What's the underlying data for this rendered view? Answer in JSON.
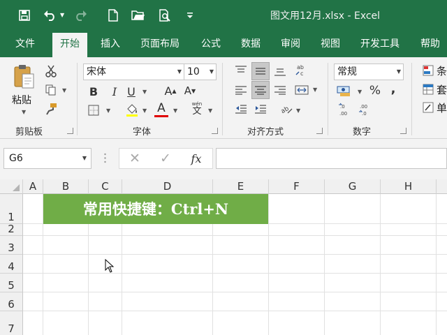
{
  "window": {
    "title": "图文用12月.xlsx  -  Excel"
  },
  "ribbon_tabs": [
    "文件",
    "开始",
    "插入",
    "页面布局",
    "公式",
    "数据",
    "审阅",
    "视图",
    "开发工具",
    "帮助"
  ],
  "clipboard": {
    "paste_label": "粘贴",
    "group_label": "剪贴板"
  },
  "font": {
    "name": "宋体",
    "size": "10",
    "group_label": "字体",
    "wen_ruby": "wén",
    "wen_char": "文"
  },
  "alignment": {
    "group_label": "对齐方式"
  },
  "number": {
    "format": "常规",
    "group_label": "数字",
    "percent": "%",
    "comma": ","
  },
  "styles": {
    "items": [
      "条",
      "套",
      "单"
    ]
  },
  "formula_bar": {
    "cell_ref": "G6",
    "fx": "fx",
    "value": ""
  },
  "grid": {
    "columns": [
      "A",
      "B",
      "C",
      "D",
      "E",
      "F",
      "G",
      "H"
    ],
    "rows": [
      "1",
      "2",
      "3",
      "4",
      "5",
      "6",
      "7"
    ],
    "merged_text": "常用快捷键：Ctrl+N"
  },
  "colors": {
    "accent": "#217346",
    "header_fill": "#70ad47",
    "font_color_bar": "#e00000"
  }
}
